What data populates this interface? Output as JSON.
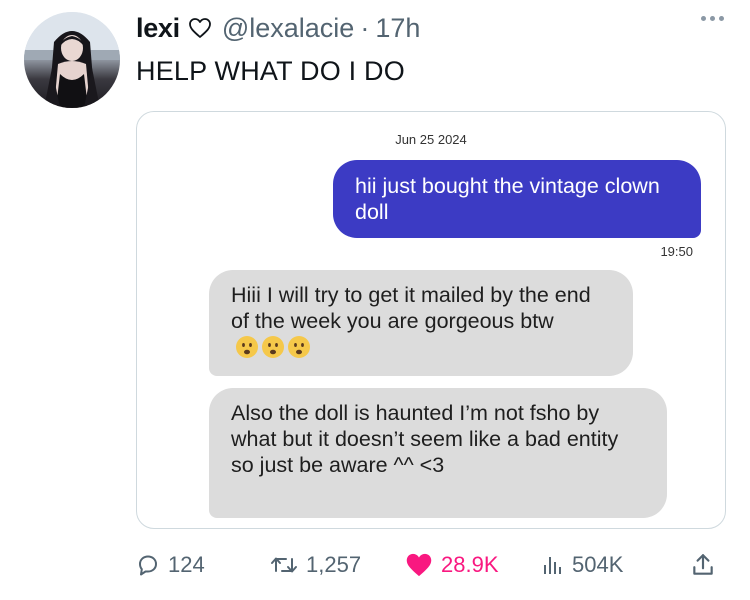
{
  "author": {
    "name": "lexi",
    "name_icon": "heart-outline-icon",
    "handle": "@lexalacie",
    "separator": "·",
    "time": "17h"
  },
  "more_icon": "more-dots-icon",
  "tweet_text": "HELP WHAT DO I DO",
  "screenshot": {
    "date": "Jun 25 2024",
    "sent": {
      "text": "hii just bought the vintage clown doll",
      "time": "19:50"
    },
    "received": [
      {
        "text": "Hiii I will try to get it mailed by the end of the week you are gorgeous btw",
        "emoji": [
          "😦",
          "😦",
          "😦"
        ]
      },
      {
        "text": "Also the doll is haunted I’m not fsho by what but it doesn’t seem like a bad entity so just be aware ^^ <3"
      }
    ],
    "colors": {
      "sent_bubble": "#3c3bc4",
      "received_bubble": "#dcdcdc"
    }
  },
  "actions": {
    "reply": {
      "icon": "reply-icon",
      "count": "124"
    },
    "retweet": {
      "icon": "retweet-icon",
      "count": "1,257"
    },
    "like": {
      "icon": "heart-filled-icon",
      "count": "28.9K",
      "color": "#f91880"
    },
    "views": {
      "icon": "views-icon",
      "count": "504K"
    },
    "share": {
      "icon": "share-icon"
    }
  }
}
